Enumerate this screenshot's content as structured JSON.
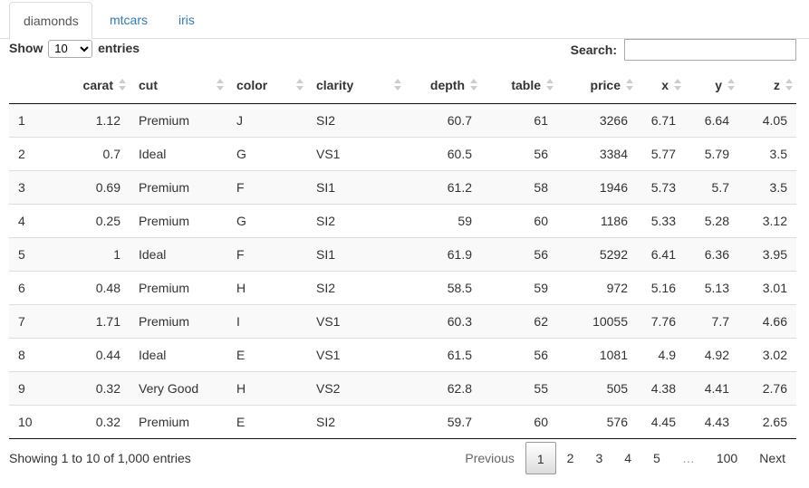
{
  "tabs": [
    {
      "label": "diamonds",
      "active": true
    },
    {
      "label": "mtcars",
      "active": false
    },
    {
      "label": "iris",
      "active": false
    }
  ],
  "length": {
    "show_label": "Show",
    "selected": "10",
    "entries_label": "entries"
  },
  "search": {
    "label": "Search:",
    "value": "",
    "placeholder": ""
  },
  "table": {
    "columns": [
      "",
      "carat",
      "cut",
      "color",
      "clarity",
      "depth",
      "table",
      "price",
      "x",
      "y",
      "z"
    ],
    "rows": [
      [
        "1",
        "1.12",
        "Premium",
        "J",
        "SI2",
        "60.7",
        "61",
        "3266",
        "6.71",
        "6.64",
        "4.05"
      ],
      [
        "2",
        "0.7",
        "Ideal",
        "G",
        "VS1",
        "60.5",
        "56",
        "3384",
        "5.77",
        "5.79",
        "3.5"
      ],
      [
        "3",
        "0.69",
        "Premium",
        "F",
        "SI1",
        "61.2",
        "58",
        "1946",
        "5.73",
        "5.7",
        "3.5"
      ],
      [
        "4",
        "0.25",
        "Premium",
        "G",
        "SI2",
        "59",
        "60",
        "1186",
        "5.33",
        "5.28",
        "3.12"
      ],
      [
        "5",
        "1",
        "Ideal",
        "F",
        "SI1",
        "61.9",
        "56",
        "5292",
        "6.41",
        "6.36",
        "3.95"
      ],
      [
        "6",
        "0.48",
        "Premium",
        "H",
        "SI2",
        "58.5",
        "59",
        "972",
        "5.16",
        "5.13",
        "3.01"
      ],
      [
        "7",
        "1.71",
        "Premium",
        "I",
        "VS1",
        "60.3",
        "62",
        "10055",
        "7.76",
        "7.7",
        "4.66"
      ],
      [
        "8",
        "0.44",
        "Ideal",
        "E",
        "VS1",
        "61.5",
        "56",
        "1081",
        "4.9",
        "4.92",
        "3.02"
      ],
      [
        "9",
        "0.32",
        "Very Good",
        "H",
        "VS2",
        "62.8",
        "55",
        "505",
        "4.38",
        "4.41",
        "2.76"
      ],
      [
        "10",
        "0.32",
        "Premium",
        "E",
        "SI2",
        "59.7",
        "60",
        "576",
        "4.45",
        "4.43",
        "2.65"
      ]
    ]
  },
  "footer": {
    "info": "Showing 1 to 10 of 1,000 entries",
    "previous": "Previous",
    "pages": [
      "1",
      "2",
      "3",
      "4",
      "5"
    ],
    "ellipsis": "…",
    "last_page": "100",
    "next": "Next",
    "current_page": "1"
  }
}
